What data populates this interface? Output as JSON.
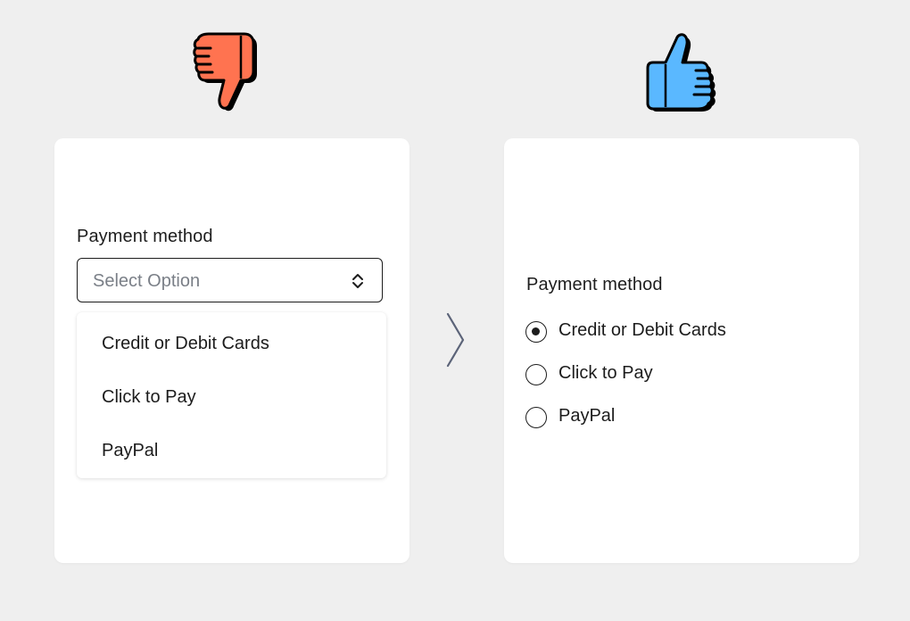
{
  "left_panel": {
    "verdict_icon": "thumbs-down-icon",
    "verdict_color": "#ff7350",
    "field_label": "Payment method",
    "select": {
      "placeholder": "Select Option",
      "icon": "chevron-up-down-icon"
    },
    "options": [
      "Credit or Debit Cards",
      "Click to Pay",
      "PayPal"
    ]
  },
  "divider_icon": "chevron-right-icon",
  "right_panel": {
    "verdict_icon": "thumbs-up-icon",
    "verdict_color": "#5ab8ff",
    "field_label": "Payment method",
    "radio_options": [
      {
        "label": "Credit or Debit Cards",
        "selected": true
      },
      {
        "label": "Click to Pay",
        "selected": false
      },
      {
        "label": "PayPal",
        "selected": false
      }
    ]
  }
}
